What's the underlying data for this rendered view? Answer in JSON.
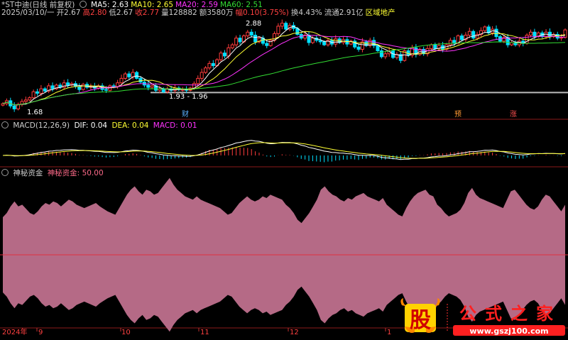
{
  "colors": {
    "up": "#ff3c3c",
    "down": "#00e0ff",
    "ma5": "#ffffff",
    "ma10": "#ffff33",
    "ma20": "#ff33ff",
    "ma60": "#33dd33",
    "fund_fill": "#b56a86",
    "sep": "#8b1a1a",
    "axis": "#c03030"
  },
  "header": {
    "title": "*ST中迪(日线 前复权)",
    "ma_line": "MA5: 2.63  MA10: 2.65  MA20: 2.59  MA60: 2.51",
    "ma": [
      {
        "label": "MA5: 2.63",
        "color": "#ffffff"
      },
      {
        "label": "MA10: 2.65",
        "color": "#ffff33"
      },
      {
        "label": "MA20: 2.59",
        "color": "#ff33ff"
      },
      {
        "label": "MA60: 2.51",
        "color": "#33dd33"
      }
    ],
    "row2": [
      {
        "t": "2025/03/10/一",
        "c": "#cccccc"
      },
      {
        "t": "开2.67",
        "c": "#cccccc"
      },
      {
        "t": "高2.80",
        "c": "#ff4040"
      },
      {
        "t": "低2.67",
        "c": "#cccccc"
      },
      {
        "t": "收2.77",
        "c": "#ff4040"
      },
      {
        "t": "量128882",
        "c": "#cccccc"
      },
      {
        "t": "额3580万",
        "c": "#cccccc"
      },
      {
        "t": "幅0.10(3.75%)",
        "c": "#ff4040"
      },
      {
        "t": "换4.43%",
        "c": "#cccccc"
      },
      {
        "t": "流通2.91亿",
        "c": "#cccccc"
      },
      {
        "t": "区域地产",
        "c": "#ffff33"
      }
    ]
  },
  "macd_header": {
    "name": "MACD(12,26,9)",
    "dif": "DIF: 0.04",
    "dea": "DEA: 0.04",
    "macd": "MACD: 0.01"
  },
  "fund_header": {
    "name": "神秘资金",
    "value": "神秘资金: 50.00"
  },
  "annotations": {
    "high": "2.88",
    "low": "1.68",
    "mid": "1.93 - 1.96"
  },
  "events": [
    {
      "label": "财",
      "color": "#5ab0ff"
    },
    {
      "label": "预",
      "color": "#ff9933"
    },
    {
      "label": "涨",
      "color": "#ff5050"
    }
  ],
  "x_axis": [
    {
      "label": "2024年"
    },
    {
      "label": "9"
    },
    {
      "label": "10"
    },
    {
      "label": "11"
    },
    {
      "label": "12"
    },
    {
      "label": "1"
    }
  ],
  "logo": {
    "chars": [
      "公",
      "式",
      "之",
      "家"
    ],
    "badge": "股",
    "url": "www.gszj100.com"
  },
  "chart_data": {
    "type": "candlestick",
    "price_range": [
      1.6,
      3.0
    ],
    "macd_range": [
      -0.1,
      0.3
    ],
    "fund_range": [
      0,
      100
    ],
    "close": [
      1.78,
      1.82,
      1.75,
      1.71,
      1.77,
      1.81,
      1.83,
      1.86,
      1.94,
      1.92,
      1.98,
      1.95,
      2.02,
      1.98,
      2.03,
      2.0,
      2.06,
      2.03,
      2.05,
      2.01,
      1.97,
      2.04,
      2.0,
      2.01,
      1.99,
      2.02,
      1.97,
      1.96,
      2.02,
      2.01,
      2.06,
      2.12,
      2.18,
      2.14,
      2.2,
      2.12,
      2.07,
      2.03,
      2.0,
      2.02,
      1.96,
      1.98,
      1.94,
      1.98,
      1.96,
      1.99,
      1.97,
      1.97,
      1.96,
      1.99,
      2.05,
      2.12,
      2.2,
      2.26,
      2.32,
      2.29,
      2.37,
      2.46,
      2.42,
      2.53,
      2.57,
      2.66,
      2.61,
      2.69,
      2.74,
      2.7,
      2.61,
      2.66,
      2.59,
      2.56,
      2.63,
      2.72,
      2.82,
      2.86,
      2.78,
      2.83,
      2.79,
      2.71,
      2.66,
      2.7,
      2.6,
      2.66,
      2.63,
      2.61,
      2.57,
      2.63,
      2.58,
      2.65,
      2.6,
      2.64,
      2.58,
      2.62,
      2.54,
      2.51,
      2.61,
      2.56,
      2.63,
      2.56,
      2.49,
      2.41,
      2.45,
      2.49,
      2.4,
      2.44,
      2.36,
      2.49,
      2.43,
      2.53,
      2.44,
      2.51,
      2.45,
      2.52,
      2.57,
      2.52,
      2.56,
      2.51,
      2.57,
      2.63,
      2.59,
      2.69,
      2.64,
      2.7,
      2.75,
      2.66,
      2.71,
      2.76,
      2.81,
      2.73,
      2.78,
      2.68,
      2.62,
      2.67,
      2.57,
      2.6,
      2.57,
      2.62,
      2.59,
      2.7,
      2.74,
      2.68,
      2.73,
      2.68,
      2.74,
      2.68,
      2.71,
      2.66,
      2.67,
      2.77
    ],
    "fund": [
      45,
      50,
      58,
      64,
      58,
      60,
      55,
      50,
      48,
      52,
      58,
      62,
      60,
      64,
      62,
      58,
      62,
      66,
      64,
      60,
      58,
      56,
      58,
      60,
      62,
      58,
      55,
      52,
      50,
      48,
      56,
      64,
      72,
      78,
      82,
      76,
      72,
      78,
      76,
      72,
      74,
      80,
      86,
      92,
      84,
      78,
      74,
      70,
      68,
      66,
      70,
      66,
      64,
      62,
      60,
      58,
      56,
      52,
      48,
      50,
      56,
      62,
      66,
      70,
      66,
      64,
      66,
      70,
      68,
      72,
      70,
      68,
      66,
      60,
      56,
      50,
      42,
      38,
      44,
      50,
      58,
      66,
      78,
      82,
      76,
      72,
      70,
      66,
      64,
      68,
      66,
      70,
      72,
      74,
      70,
      68,
      66,
      64,
      68,
      60,
      56,
      52,
      48,
      46,
      56,
      64,
      70,
      74,
      76,
      78,
      72,
      70,
      60,
      56,
      50,
      46,
      48,
      50,
      54,
      62,
      74,
      80,
      72,
      68,
      66,
      64,
      62,
      60,
      58,
      56,
      66,
      76,
      78,
      72,
      66,
      60,
      56,
      54,
      58,
      66,
      72,
      70,
      64,
      58,
      52,
      60
    ]
  }
}
